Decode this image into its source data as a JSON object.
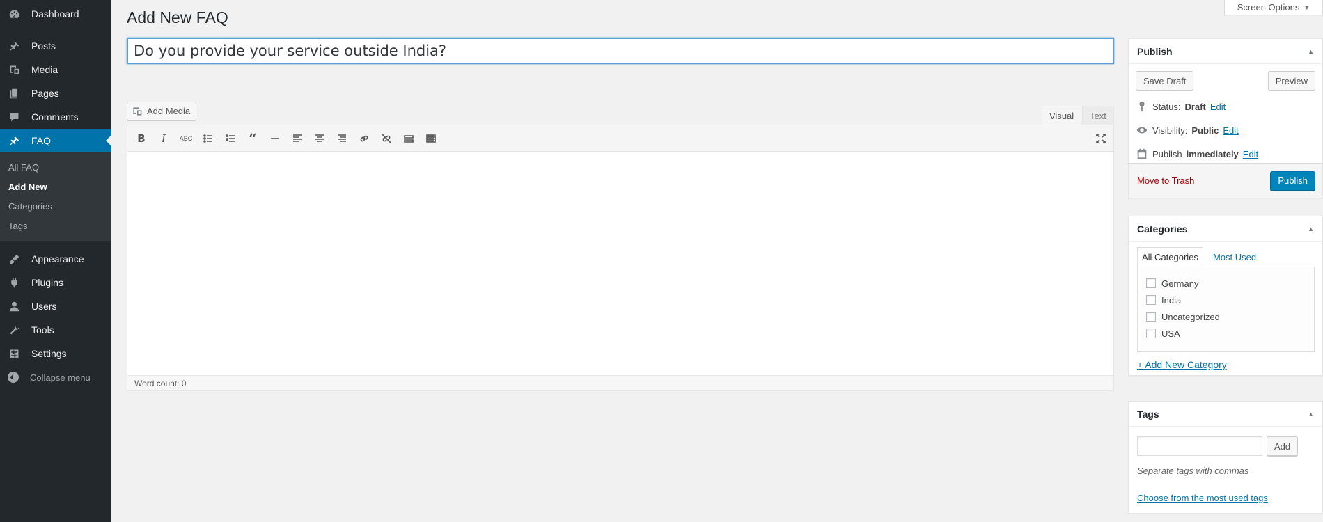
{
  "sidebar": {
    "items": [
      {
        "label": "Dashboard",
        "icon": "dashboard-icon"
      },
      {
        "label": "Posts",
        "icon": "pin-icon"
      },
      {
        "label": "Media",
        "icon": "media-icon"
      },
      {
        "label": "Pages",
        "icon": "pages-icon"
      },
      {
        "label": "Comments",
        "icon": "comment-icon"
      },
      {
        "label": "FAQ",
        "icon": "pin-icon"
      },
      {
        "label": "Appearance",
        "icon": "brush-icon"
      },
      {
        "label": "Plugins",
        "icon": "plugin-icon"
      },
      {
        "label": "Users",
        "icon": "user-icon"
      },
      {
        "label": "Tools",
        "icon": "wrench-icon"
      },
      {
        "label": "Settings",
        "icon": "settings-icon"
      }
    ],
    "faq_submenu": [
      "All FAQ",
      "Add New",
      "Categories",
      "Tags"
    ],
    "collapse_label": "Collapse menu"
  },
  "header": {
    "screen_options": "Screen Options",
    "page_title": "Add New FAQ"
  },
  "editor": {
    "title_value": "Do you provide your service outside India?",
    "add_media": "Add Media",
    "tab_visual": "Visual",
    "tab_text": "Text",
    "word_count": "Word count: 0"
  },
  "publish": {
    "title": "Publish",
    "save_draft": "Save Draft",
    "preview": "Preview",
    "status_label": "Status:",
    "status_value": "Draft",
    "visibility_label": "Visibility:",
    "visibility_value": "Public",
    "publish_label": "Publish",
    "publish_value": "immediately",
    "edit": "Edit",
    "move_to_trash": "Move to Trash",
    "publish_button": "Publish"
  },
  "categories": {
    "title": "Categories",
    "tab_all": "All Categories",
    "tab_most_used": "Most Used",
    "items": [
      "Germany",
      "India",
      "Uncategorized",
      "USA"
    ],
    "add_new": "+ Add New Category"
  },
  "tags": {
    "title": "Tags",
    "add_button": "Add",
    "hint": "Separate tags with commas",
    "choose": "Choose from the most used tags"
  },
  "colors": {
    "sidebar_bg": "#23282d",
    "accent": "#0073aa",
    "primary_button": "#0085ba",
    "trash": "#a00"
  }
}
